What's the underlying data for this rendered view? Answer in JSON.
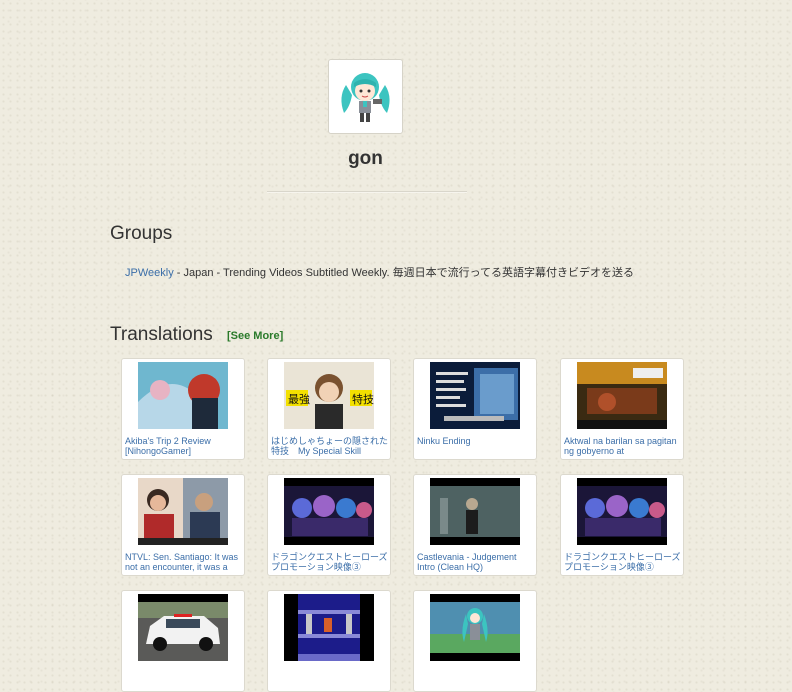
{
  "profile": {
    "username": "gon",
    "avatar_icon": "hatsune-miku-chibi-avatar"
  },
  "groups": {
    "title": "Groups",
    "items": [
      {
        "name": "JPWeekly",
        "description": " - Japan - Trending Videos Subtitled Weekly. 毎週日本で流行ってる英語字幕付きビデオを送る"
      }
    ]
  },
  "translations": {
    "title": "Translations",
    "see_more": "[See More]",
    "items": [
      {
        "title": "Akiba's Trip 2 Review [NihongoGamer]",
        "thumb": "anime-characters"
      },
      {
        "title": "はじめしゃちょーの隠された特技　My Special Skill",
        "thumb": "youtuber-closeup"
      },
      {
        "title": "Ninku Ending",
        "thumb": "anime-credits"
      },
      {
        "title": "Aktwal na barilan sa pagitan ng gobyerno at",
        "thumb": "news-footage"
      },
      {
        "title": "NTVL: Sen. Santiago: It was not an encounter, it was a",
        "thumb": "senate-hearing"
      },
      {
        "title": "ドラゴンクエストヒーローズ　プロモーション映像③",
        "thumb": "game-characters"
      },
      {
        "title": "Castlevania - Judgement Intro (Clean HQ)",
        "thumb": "castlevania-scene"
      },
      {
        "title": "ドラゴンクエストヒーローズ　プロモーション映像③",
        "thumb": "game-characters"
      },
      {
        "title": "",
        "thumb": "police-car"
      },
      {
        "title": "",
        "thumb": "retro-game"
      },
      {
        "title": "",
        "thumb": "miku-stage"
      }
    ]
  },
  "colors": {
    "link": "#3b6ea8",
    "see_more": "#2a7a2a",
    "background": "#efece0"
  }
}
